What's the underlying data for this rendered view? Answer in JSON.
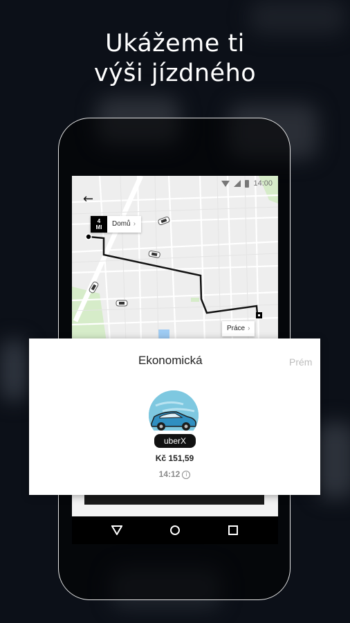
{
  "headline": {
    "line1": "Ukážeme ti",
    "line2": "výši jízdného"
  },
  "status_bar": {
    "time": "14:00"
  },
  "map": {
    "eta_value": "4",
    "eta_unit": "MI",
    "origin_label": "Domů",
    "destination_label": "Práce"
  },
  "product_card": {
    "tabs": [
      "Ekonomická",
      "Prém"
    ],
    "product_name": "uberX",
    "price": "Kč 151,59",
    "arrival_time": "14:12"
  },
  "nav": {
    "back": "back-icon",
    "home": "home-icon",
    "recents": "recents-icon"
  },
  "colors": {
    "accent_sky": "#7ec8e0",
    "car_blue": "#2f8fc1"
  }
}
